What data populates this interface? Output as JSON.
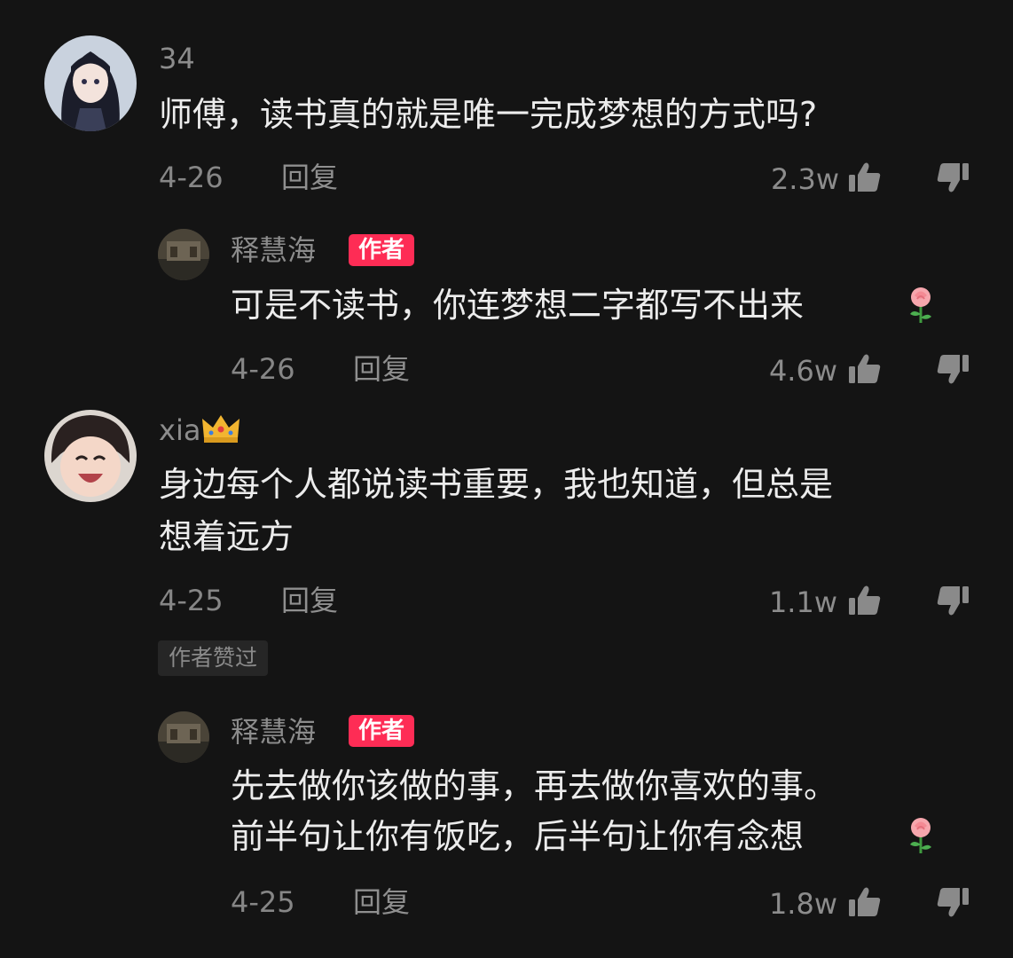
{
  "comments": [
    {
      "user": "34",
      "content_lines": [
        "师傅，读书真的就是唯一完成梦想的方式吗?"
      ],
      "date": "4-26",
      "reply_label": "回复",
      "likes": "2.3w"
    },
    {
      "user": "释慧海",
      "badge": "作者",
      "content_lines": [
        "可是不读书，你连梦想二字都写不出来"
      ],
      "date": "4-26",
      "reply_label": "回复",
      "likes": "4.6w"
    },
    {
      "user": "xia",
      "content_lines": [
        "身边每个人都说读书重要，我也知道，但总是",
        "想着远方"
      ],
      "date": "4-25",
      "reply_label": "回复",
      "likes": "1.1w",
      "tag": "作者赞过"
    },
    {
      "user": "释慧海",
      "badge": "作者",
      "content_lines": [
        "先去做你该做的事，再去做你喜欢的事。",
        "前半句让你有饭吃，后半句让你有念想"
      ],
      "date": "4-25",
      "reply_label": "回复",
      "likes": "1.8w"
    }
  ],
  "colors": {
    "background": "#141414",
    "author_badge": "#fe2c55",
    "meta_text": "#868686",
    "content_text": "#ececec"
  },
  "icons": [
    "thumbs-up-icon",
    "thumbs-down-icon",
    "rose-emoji",
    "crown-emoji"
  ]
}
